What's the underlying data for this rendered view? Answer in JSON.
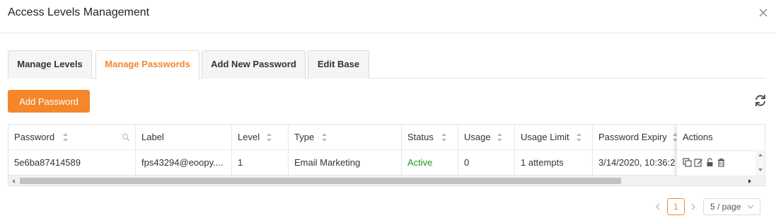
{
  "dialog": {
    "title": "Access Levels Management"
  },
  "tabs": [
    {
      "label": "Manage Levels",
      "active": false
    },
    {
      "label": "Manage Passwords",
      "active": true
    },
    {
      "label": "Add New Password",
      "active": false
    },
    {
      "label": "Edit Base",
      "active": false
    }
  ],
  "toolbar": {
    "add_label": "Add Password"
  },
  "table": {
    "columns": [
      "Password",
      "Label",
      "Level",
      "Type",
      "Status",
      "Usage",
      "Usage Limit",
      "Password Expiry",
      "Actions"
    ],
    "rows": [
      {
        "password": "5e6ba87414589",
        "label": "fps43294@eoopy....",
        "level": "1",
        "type": "Email Marketing",
        "status": "Active",
        "usage": "0",
        "usage_limit": "1 attempts",
        "expiry": "3/14/2020, 10:36:2"
      }
    ]
  },
  "pagination": {
    "current": "1",
    "page_size": "5 / page"
  },
  "colors": {
    "accent": "#f5862b",
    "active_status": "#1a9a1a"
  }
}
